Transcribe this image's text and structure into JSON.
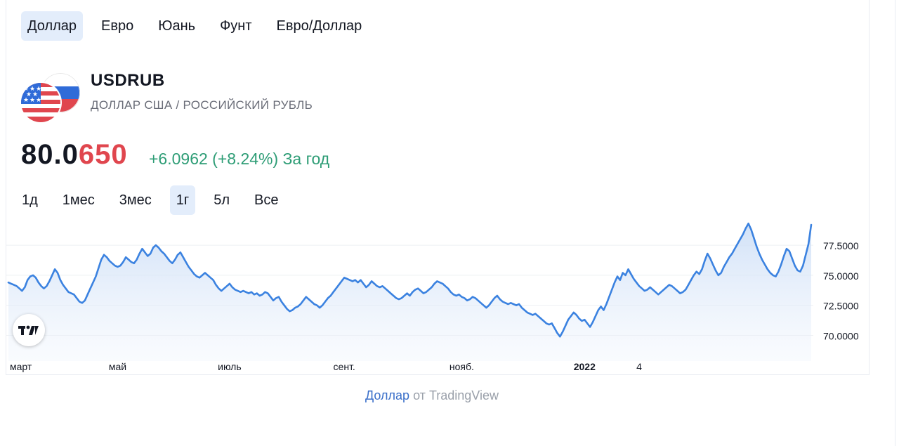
{
  "tabs": [
    {
      "label": "Доллар",
      "active": true
    },
    {
      "label": "Евро",
      "active": false
    },
    {
      "label": "Юань",
      "active": false
    },
    {
      "label": "Фунт",
      "active": false
    },
    {
      "label": "Евро/Доллар",
      "active": false
    }
  ],
  "symbol": {
    "ticker": "USDRUB",
    "description": "ДОЛЛАР США / РОССИЙСКИЙ РУБЛЬ",
    "price_main": "80.0",
    "price_tail": "650",
    "change": "+6.0962 (+8.24%) За год"
  },
  "ranges": [
    {
      "label": "1д",
      "active": false
    },
    {
      "label": "1мес",
      "active": false
    },
    {
      "label": "3мес",
      "active": false
    },
    {
      "label": "1г",
      "active": true
    },
    {
      "label": "5л",
      "active": false
    },
    {
      "label": "Все",
      "active": false
    }
  ],
  "footer": {
    "link": "Доллар",
    "from": "от",
    "brand": "TradingView"
  },
  "colors": {
    "line": "#3b82e0",
    "up": "#2e9d76",
    "down": "#e0464e",
    "active_bg": "#e3edfb"
  },
  "icons": [
    "usa-flag-icon",
    "russia-flag-icon",
    "tradingview-logo-icon"
  ],
  "chart_data": {
    "type": "area",
    "xlabel": "",
    "ylabel": "",
    "ylim": [
      68.1,
      79.9
    ],
    "yticks": [
      {
        "value": 70,
        "label": "70.0000"
      },
      {
        "value": 72.5,
        "label": "72.5000"
      },
      {
        "value": 75,
        "label": "75.0000"
      },
      {
        "value": 77.5,
        "label": "77.5000"
      }
    ],
    "xticks": [
      {
        "index": 0,
        "label": "март"
      },
      {
        "index": 40,
        "label": "май"
      },
      {
        "index": 81,
        "label": "июль"
      },
      {
        "index": 123,
        "label": "сент."
      },
      {
        "index": 166,
        "label": "нояб."
      },
      {
        "index": 211,
        "label": "2022"
      },
      {
        "index": 231,
        "label": "4"
      }
    ],
    "series": [
      {
        "values": [
          74.4,
          74.3,
          74.2,
          74.1,
          73.9,
          73.7,
          74.0,
          74.6,
          74.9,
          75.0,
          74.8,
          74.4,
          74.1,
          73.9,
          74.1,
          74.5,
          75.0,
          75.5,
          75.2,
          74.6,
          74.2,
          73.9,
          73.6,
          73.5,
          73.4,
          73.1,
          72.8,
          72.7,
          72.9,
          73.4,
          73.9,
          74.4,
          74.9,
          75.6,
          76.3,
          76.7,
          76.5,
          76.2,
          76.0,
          75.8,
          75.7,
          75.8,
          76.1,
          76.5,
          76.3,
          76.1,
          76.0,
          76.3,
          76.8,
          77.2,
          76.9,
          76.6,
          76.8,
          77.3,
          77.5,
          77.3,
          77.0,
          76.8,
          76.5,
          76.2,
          76.0,
          76.3,
          76.7,
          76.9,
          76.5,
          76.1,
          75.7,
          75.4,
          75.1,
          74.9,
          74.8,
          75.0,
          75.2,
          75.0,
          74.8,
          74.6,
          74.2,
          73.9,
          73.7,
          73.9,
          74.1,
          74.3,
          74.0,
          73.8,
          73.7,
          73.6,
          73.7,
          73.6,
          73.5,
          73.6,
          73.4,
          73.5,
          73.3,
          73.4,
          73.6,
          73.5,
          73.2,
          72.9,
          73.1,
          73.2,
          72.8,
          72.5,
          72.2,
          72.0,
          72.1,
          72.3,
          72.4,
          72.6,
          72.9,
          73.2,
          73.0,
          72.8,
          72.6,
          72.5,
          72.3,
          72.5,
          72.8,
          73.1,
          73.3,
          73.6,
          73.9,
          74.2,
          74.5,
          74.8,
          74.7,
          74.6,
          74.5,
          74.6,
          74.4,
          74.6,
          74.3,
          74.0,
          74.2,
          74.5,
          74.3,
          74.1,
          74.0,
          74.1,
          73.9,
          73.7,
          73.5,
          73.3,
          73.1,
          73.0,
          73.1,
          73.3,
          73.5,
          73.3,
          73.6,
          73.8,
          73.9,
          73.7,
          73.5,
          73.6,
          73.8,
          74.0,
          74.3,
          74.5,
          74.4,
          74.3,
          74.1,
          73.9,
          73.6,
          73.4,
          73.3,
          73.4,
          73.2,
          73.1,
          72.9,
          73.0,
          73.2,
          73.1,
          72.9,
          72.7,
          72.5,
          72.3,
          72.5,
          72.8,
          73.1,
          73.3,
          73.0,
          72.8,
          72.7,
          72.6,
          72.7,
          72.6,
          72.5,
          72.6,
          72.3,
          72.1,
          71.9,
          71.8,
          71.7,
          71.8,
          71.6,
          71.4,
          71.2,
          71.0,
          70.9,
          71.0,
          70.6,
          70.2,
          69.9,
          70.3,
          70.8,
          71.3,
          71.6,
          71.9,
          71.7,
          71.4,
          71.2,
          71.3,
          71.0,
          70.7,
          71.1,
          71.6,
          72.1,
          72.4,
          72.1,
          72.6,
          73.2,
          73.8,
          74.4,
          74.9,
          74.6,
          75.2,
          75.0,
          75.5,
          75.1,
          74.7,
          74.4,
          74.1,
          73.9,
          73.7,
          73.8,
          74.0,
          73.8,
          73.6,
          73.4,
          73.6,
          73.8,
          74.0,
          74.2,
          74.1,
          73.9,
          73.7,
          73.5,
          73.6,
          73.8,
          74.2,
          74.6,
          75.0,
          75.3,
          75.1,
          75.5,
          76.2,
          76.8,
          76.4,
          75.9,
          75.4,
          75.0,
          75.2,
          75.7,
          76.1,
          76.5,
          76.8,
          77.2,
          77.6,
          78.0,
          78.4,
          78.9,
          79.3,
          78.8,
          78.1,
          77.4,
          76.8,
          76.3,
          75.9,
          75.5,
          75.2,
          75.0,
          74.9,
          75.3,
          75.9,
          76.6,
          77.2,
          77.0,
          76.4,
          75.8,
          75.4,
          75.3,
          75.8,
          76.7,
          77.6,
          79.2
        ]
      }
    ]
  }
}
